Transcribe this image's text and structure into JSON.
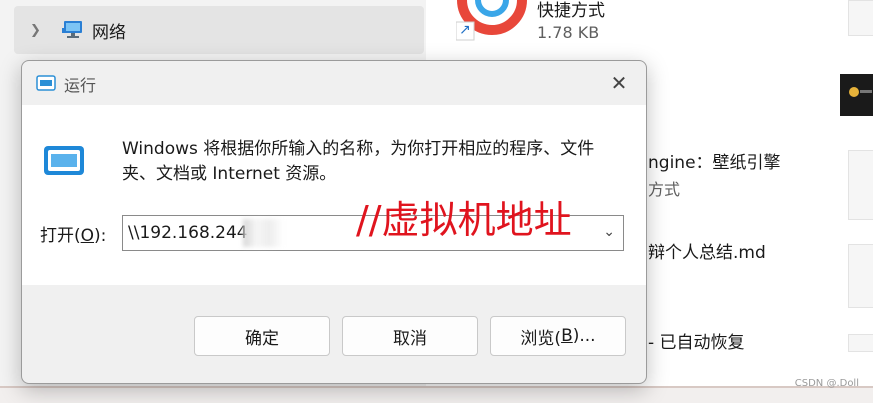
{
  "explorer": {
    "nav_item_label": "网络",
    "files": [
      {
        "name": "快捷方式",
        "detail": "1.78 KB"
      },
      {
        "name": "ngine：壁纸引擎",
        "detail": "方式"
      },
      {
        "name": "辩个人总结.md"
      },
      {
        "name": "-  已自动恢复"
      }
    ],
    "watermark": "CSDN @.Doll"
  },
  "run_dialog": {
    "title": "运行",
    "description_line1": "Windows 将根据你所输入的名称，为你打开相应的程序、文件",
    "description_line2": "夹、文档或 Internet 资源。",
    "open_label_prefix": "打开(",
    "open_label_key": "O",
    "open_label_suffix": "):",
    "open_value": "\\\\192.168.244",
    "annotation": "//虚拟机地址",
    "ok_label": "确定",
    "cancel_label": "取消",
    "browse_label_prefix": "浏览(",
    "browse_label_key": "B",
    "browse_label_suffix": ")..."
  },
  "colors": {
    "annotation": "#e0141e",
    "dialog_bg": "#f0f0f0"
  },
  "icons": [
    "chevron-right-icon",
    "network-icon",
    "run-app-icon",
    "close-icon",
    "chevron-down-icon",
    "shortcut-arrow-icon"
  ]
}
